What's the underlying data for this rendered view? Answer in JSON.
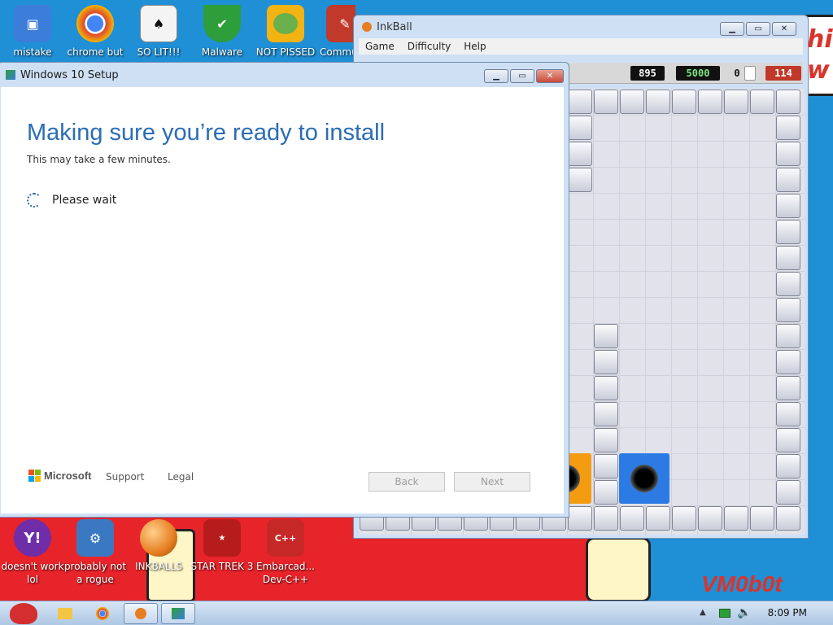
{
  "desktop": {
    "top_icons": [
      {
        "label": "mistake",
        "icon": "computer-icon",
        "color": "#f0a500"
      },
      {
        "label": "chrome but",
        "icon": "chrome-icon",
        "color": "#4285f4"
      },
      {
        "label": "SO LIT!!!",
        "icon": "cards-icon",
        "color": "#ffffff"
      },
      {
        "label": "Malware",
        "icon": "shield-icon",
        "color": "#2e9e3a"
      },
      {
        "label": "NOT PISSED",
        "icon": "pig-icon",
        "color": "#6ab04c"
      },
      {
        "label": "Commu",
        "icon": "community-icon",
        "color": "#c0392b"
      }
    ],
    "bottom_icons": [
      {
        "label": "doesn't work lol",
        "icon": "yahoo-icon",
        "color": "#6f2da8"
      },
      {
        "label": "probably not a rogue",
        "icon": "gears-icon",
        "color": "#3a78c2"
      },
      {
        "label": "INKBALLS",
        "icon": "inkball-icon",
        "color": "#e67e22"
      },
      {
        "label": "STAR TREK 3",
        "icon": "startrek-icon",
        "color": "#b71c1c"
      },
      {
        "label": "Embarcad... Dev-C++",
        "icon": "devcpp-icon",
        "color": "#c62828"
      }
    ],
    "wallpaper_text": "hi\nw",
    "signature": "VM0b0t"
  },
  "setup": {
    "title": "Windows 10 Setup",
    "heading": "Making sure you’re ready to install",
    "subheading": "This may take a few minutes.",
    "status": "Please wait",
    "brand": "Microsoft",
    "support": "Support",
    "legal": "Legal",
    "back": "Back",
    "next": "Next"
  },
  "inkball": {
    "title": "InkBall",
    "menu": [
      "Game",
      "Difficulty",
      "Help"
    ],
    "time": "895",
    "score": "5000",
    "lives_count": "0",
    "level_score": "114"
  },
  "taskbar": {
    "clock": "8:09 PM"
  },
  "colors": {
    "accent": "#2b6cb5",
    "ink_orange": "#f39c12",
    "ink_blue": "#2c7be5",
    "score_red": "#c0392b",
    "score_green": "#7ee787"
  }
}
